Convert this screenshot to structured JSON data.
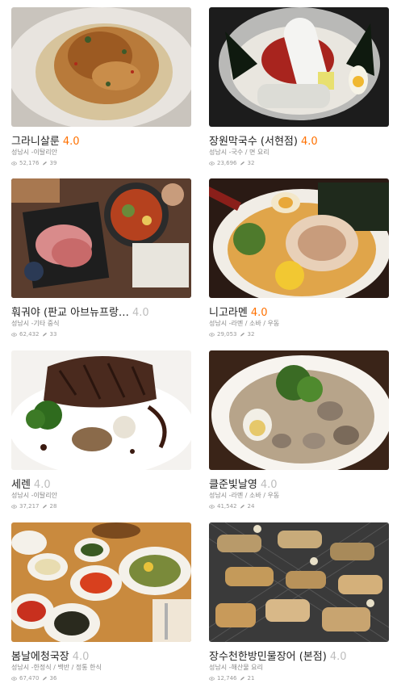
{
  "restaurants": [
    {
      "name": "그라니살룬",
      "rating": "4.0",
      "rating_level": "high",
      "location": "성남시",
      "category": "이탈리안",
      "views": "52,176",
      "reviews": "39"
    },
    {
      "name": "장원막국수 (서현점)",
      "rating": "4.0",
      "rating_level": "high",
      "location": "성남시",
      "category": "국수 / 면 요리",
      "views": "23,696",
      "reviews": "32"
    },
    {
      "name": "훠궈야 (판교 아브뉴프랑…",
      "rating": "4.0",
      "rating_level": "low",
      "location": "성남시",
      "category": "기타 중식",
      "views": "62,432",
      "reviews": "33"
    },
    {
      "name": "니고라멘",
      "rating": "4.0",
      "rating_level": "high",
      "location": "성남시",
      "category": "라멘 / 소바 / 우동",
      "views": "29,053",
      "reviews": "32"
    },
    {
      "name": "세렌",
      "rating": "4.0",
      "rating_level": "low",
      "location": "성남시",
      "category": "이탈리안",
      "views": "37,217",
      "reviews": "28"
    },
    {
      "name": "클준빛날영",
      "rating": "4.0",
      "rating_level": "low",
      "location": "성남시",
      "category": "라멘 / 소바 / 우동",
      "views": "41,542",
      "reviews": "24"
    },
    {
      "name": "봄날에청국장",
      "rating": "4.0",
      "rating_level": "low",
      "location": "성남시",
      "category": "한정식 / 백반 / 정통 한식",
      "views": "67,470",
      "reviews": "36"
    },
    {
      "name": "장수천한방민물장어 (본점)",
      "rating": "4.0",
      "rating_level": "low",
      "location": "성남시",
      "category": "해산물 요리",
      "views": "12,746",
      "reviews": "21"
    }
  ],
  "separator": " -",
  "icons": {
    "views": "eye-icon",
    "reviews": "pencil-icon"
  },
  "colors": {
    "rating_high": "#ff7100",
    "rating_low": "#bdbdbd"
  }
}
